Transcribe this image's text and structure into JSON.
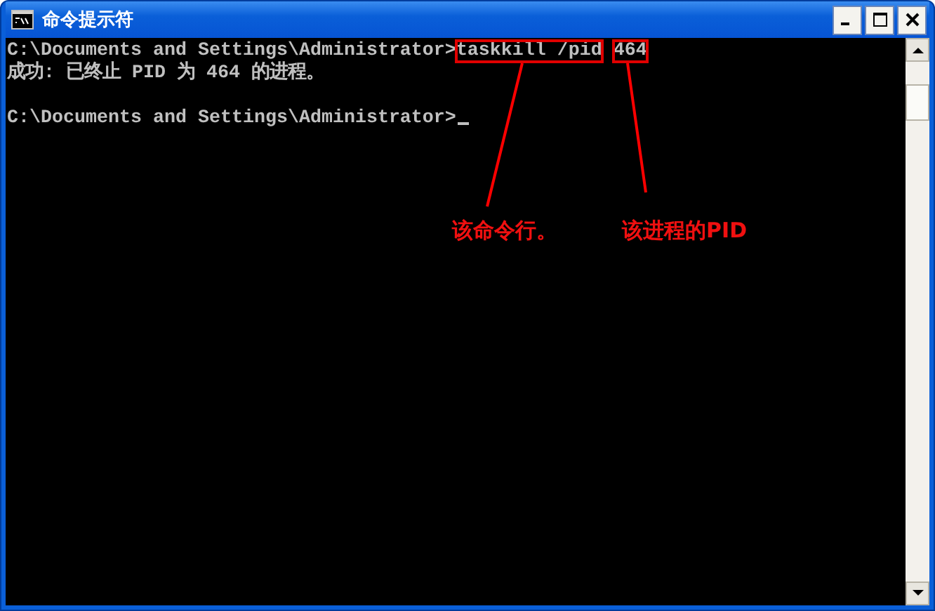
{
  "window": {
    "title": "命令提示符"
  },
  "console": {
    "lines": [
      {
        "kind": "command",
        "prompt": "C:\\Documents and Settings\\Administrator>",
        "command": "taskkill /pid",
        "argument": "464"
      },
      {
        "kind": "output",
        "text": "成功: 已终止 PID 为 464 的进程。"
      },
      {
        "kind": "blank"
      },
      {
        "kind": "prompt",
        "prompt": "C:\\Documents and Settings\\Administrator>"
      }
    ]
  },
  "annotations": [
    {
      "kind": "command",
      "label": "该命令行。"
    },
    {
      "kind": "argument",
      "label": "该进程的PID"
    }
  ]
}
